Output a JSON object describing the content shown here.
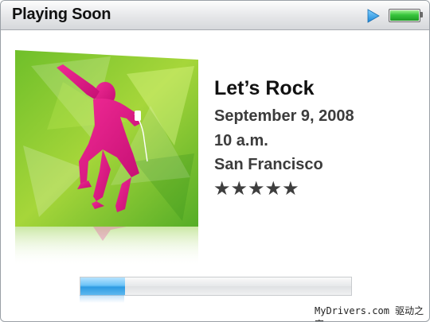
{
  "header": {
    "title": "Playing Soon",
    "play_icon": "play-icon",
    "battery_icon": "battery-icon",
    "battery_level": 1.0
  },
  "now_playing": {
    "title": "Let’s Rock",
    "date": "September 9, 2008",
    "time": "10 a.m.",
    "location": "San Francisco",
    "rating_stars": 5,
    "rating_text": "★★★★★"
  },
  "progress": {
    "fraction": 0.165
  },
  "watermark": "MyDrivers.com 驱动之家",
  "colors": {
    "accent_blue": "#2e9be2",
    "battery_green": "#37c53c",
    "art_magenta": "#d6157f",
    "art_green": "#8ed12a"
  }
}
